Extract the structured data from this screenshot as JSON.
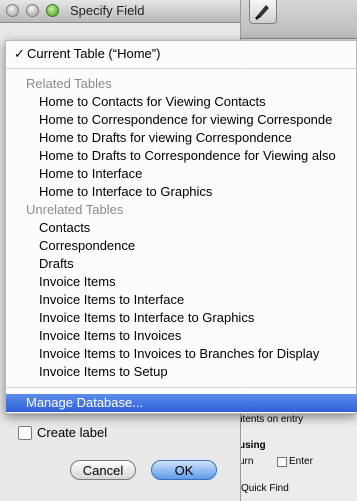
{
  "dialog": {
    "title": "Specify Field",
    "create_label": "Create label",
    "cancel_label": "Cancel",
    "ok_label": "OK"
  },
  "menu": {
    "current_table": "Current Table (“Home”)",
    "related_header": "Related Tables",
    "related": [
      "Home to Contacts for Viewing Contacts",
      "Home to Correspondence for viewing Corresponde",
      "Home to Drafts for viewing Correspondence",
      "Home to Drafts to Correspondence for Viewing also",
      "Home to Interface",
      "Home to Interface to Graphics"
    ],
    "unrelated_header": "Unrelated Tables",
    "unrelated": [
      "Contacts",
      "Correspondence",
      "Drafts",
      "Invoice Items",
      "Invoice Items to Interface",
      "Invoice Items to Interface to Graphics",
      "Invoice Items to Invoices",
      "Invoice Items to Invoices to Branches for Display",
      "Invoice Items to Setup"
    ],
    "manage": "Manage Database..."
  },
  "background": {
    "entry_text": "ntents on entry",
    "using_text": "using",
    "return_text": "urn",
    "enter_text": "Enter",
    "quickfind_text": "Quick Find"
  }
}
